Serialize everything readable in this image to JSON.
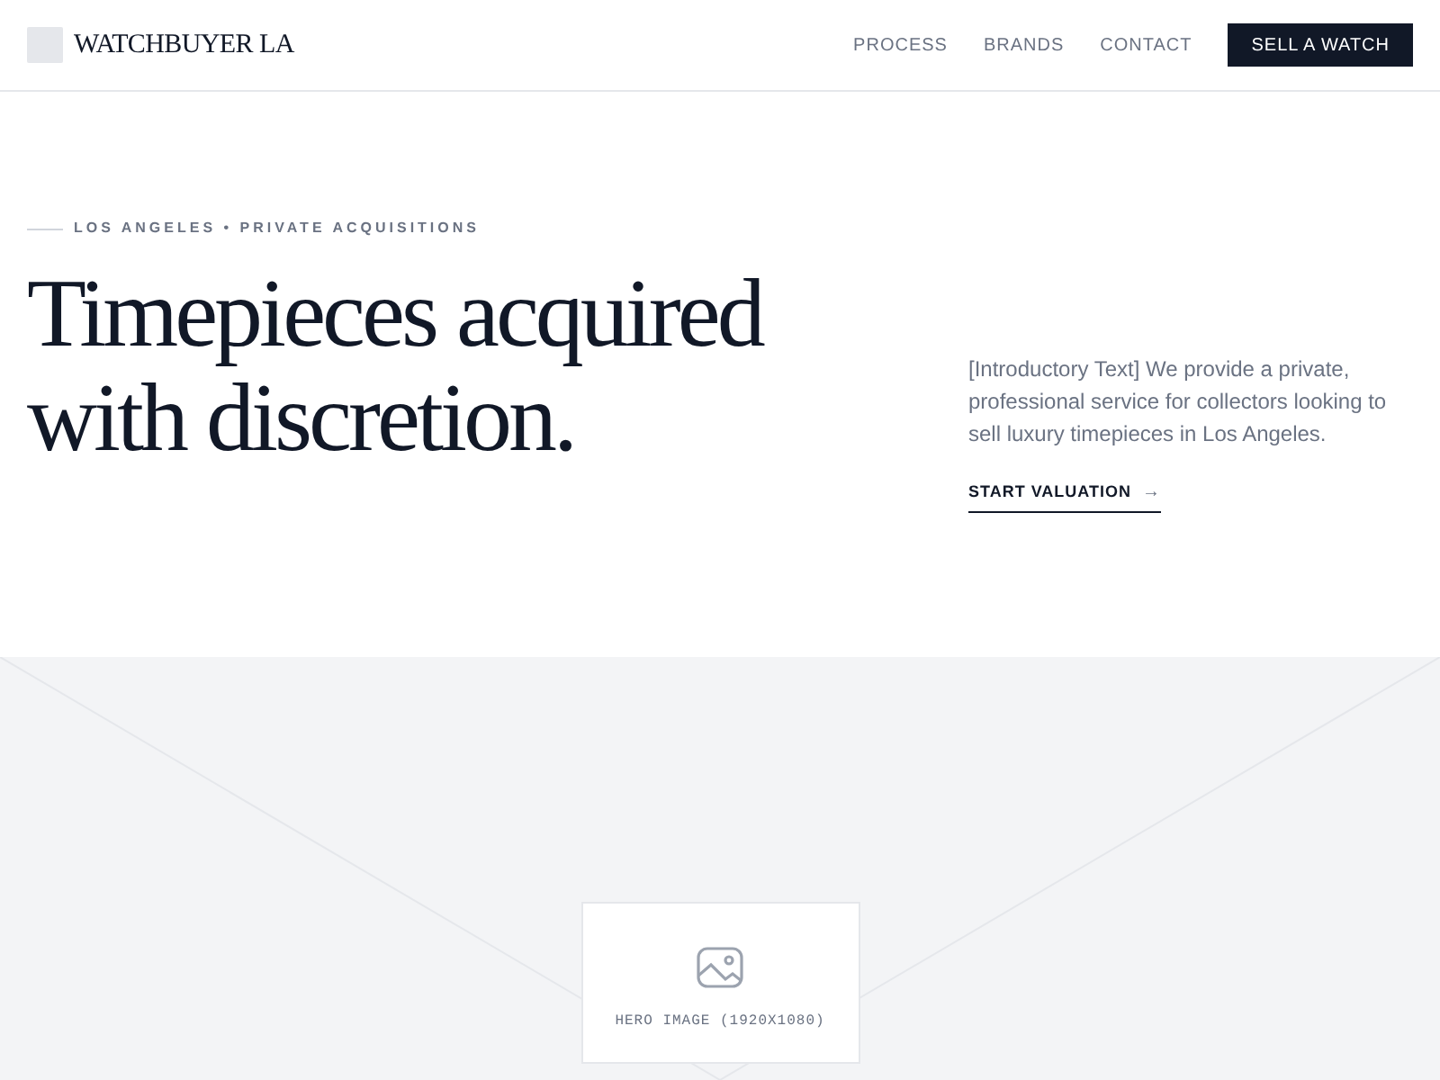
{
  "brand": {
    "name": "WATCHBUYER LA"
  },
  "nav": {
    "links": [
      "PROCESS",
      "BRANDS",
      "CONTACT"
    ],
    "cta": "SELL A WATCH"
  },
  "hero": {
    "eyebrow": "LOS ANGELES • PRIVATE ACQUISITIONS",
    "heading_lines": [
      "Timepieces acquired",
      "with discretion."
    ],
    "intro": "[Introductory Text] We provide a private, professional service for collectors looking to sell luxury timepieces in Los Angeles.",
    "link": "START VALUATION",
    "link_arrow": "→"
  },
  "placeholder": {
    "label": "HERO IMAGE (1920X1080)"
  }
}
